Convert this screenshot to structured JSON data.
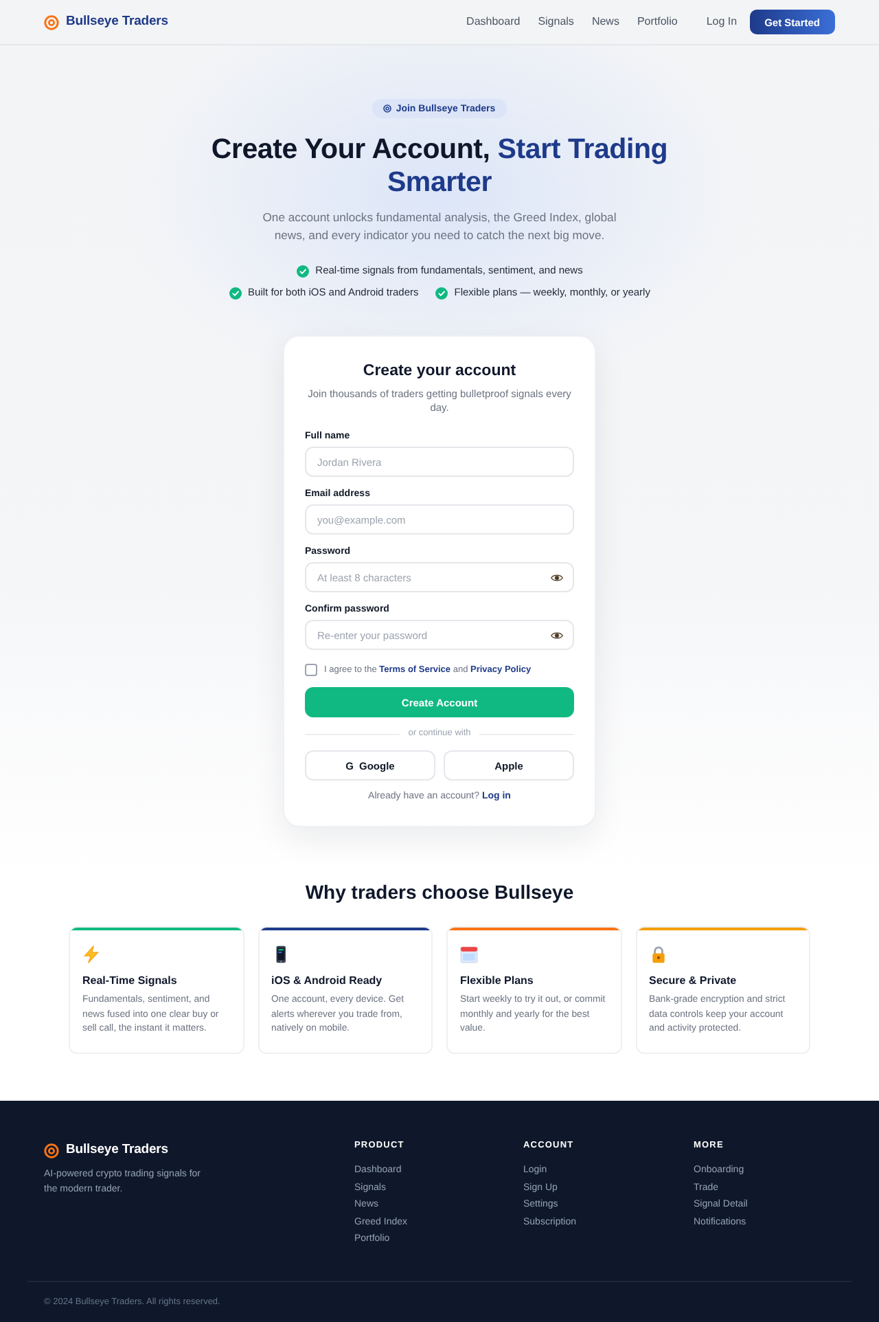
{
  "header": {
    "brand": "Bullseye Traders",
    "nav": [
      "Dashboard",
      "Signals",
      "News",
      "Portfolio"
    ],
    "login": "Log In",
    "cta": "Get Started"
  },
  "hero": {
    "badge": "Join Bullseye Traders",
    "title": "Create Your Account,",
    "title_highlight": "Start Trading Smarter",
    "subtitle": "One account unlocks fundamental analysis, the Greed Index, global news, and every indicator you need to catch the next big move.",
    "highlights": [
      "Real-time signals from fundamentals, sentiment, and news",
      "Built for both iOS and Android traders",
      "Flexible plans — weekly, monthly, or yearly"
    ]
  },
  "signup_form": {
    "title": "Create your account",
    "subtitle": "Join thousands of traders getting bulletproof signals every day.",
    "fields": [
      {
        "kind": "text",
        "label": "Full name",
        "placeholder": "Jordan Rivera"
      },
      {
        "kind": "email",
        "label": "Email address",
        "placeholder": "you@example.com"
      },
      {
        "kind": "password",
        "label": "Password",
        "placeholder": "At least 8 characters"
      },
      {
        "kind": "password",
        "label": "Confirm password",
        "placeholder": "Re-enter your password"
      }
    ],
    "terms": {
      "checked": false,
      "text_before": "I agree to the",
      "terms_link": "Terms of Service",
      "text_middle": "and",
      "privacy_link": "Privacy Policy"
    },
    "submit": "Create Account",
    "divider": "or continue with",
    "social": [
      {
        "glyph": "G",
        "label": "Google"
      },
      {
        "label": "Apple"
      }
    ],
    "login_prompt": "Already have an account?",
    "login_link": "Log in"
  },
  "features": {
    "title": "Why traders choose Bullseye",
    "items": [
      {
        "title": "Real-Time Signals",
        "description": "Fundamentals, sentiment, and news fused into one clear buy or sell call, the instant it matters.",
        "color": "#10b981"
      },
      {
        "title": "iOS & Android Ready",
        "description": "One account, every device. Get alerts wherever you trade from, natively on mobile.",
        "color": "#1e3a8a"
      },
      {
        "title": "Flexible Plans",
        "description": "Start weekly to try it out, or commit monthly and yearly for the best value.",
        "color": "#f97316"
      },
      {
        "title": "Secure & Private",
        "description": "Bank-grade encryption and strict data controls keep your account and activity protected.",
        "color": "#f59e0b"
      }
    ]
  },
  "footer": {
    "brand": "Bullseye Traders",
    "tagline": "AI-powered crypto trading signals for the modern trader.",
    "columns": [
      {
        "heading": "PRODUCT",
        "links": [
          "Dashboard",
          "Signals",
          "News",
          "Greed Index",
          "Portfolio"
        ]
      },
      {
        "heading": "ACCOUNT",
        "links": [
          "Login",
          "Sign Up",
          "Settings",
          "Subscription"
        ]
      },
      {
        "heading": "MORE",
        "links": [
          "Onboarding",
          "Trade",
          "Signal Detail",
          "Notifications"
        ]
      }
    ],
    "copyright": "© 2024 Bullseye Traders. All rights reserved."
  }
}
